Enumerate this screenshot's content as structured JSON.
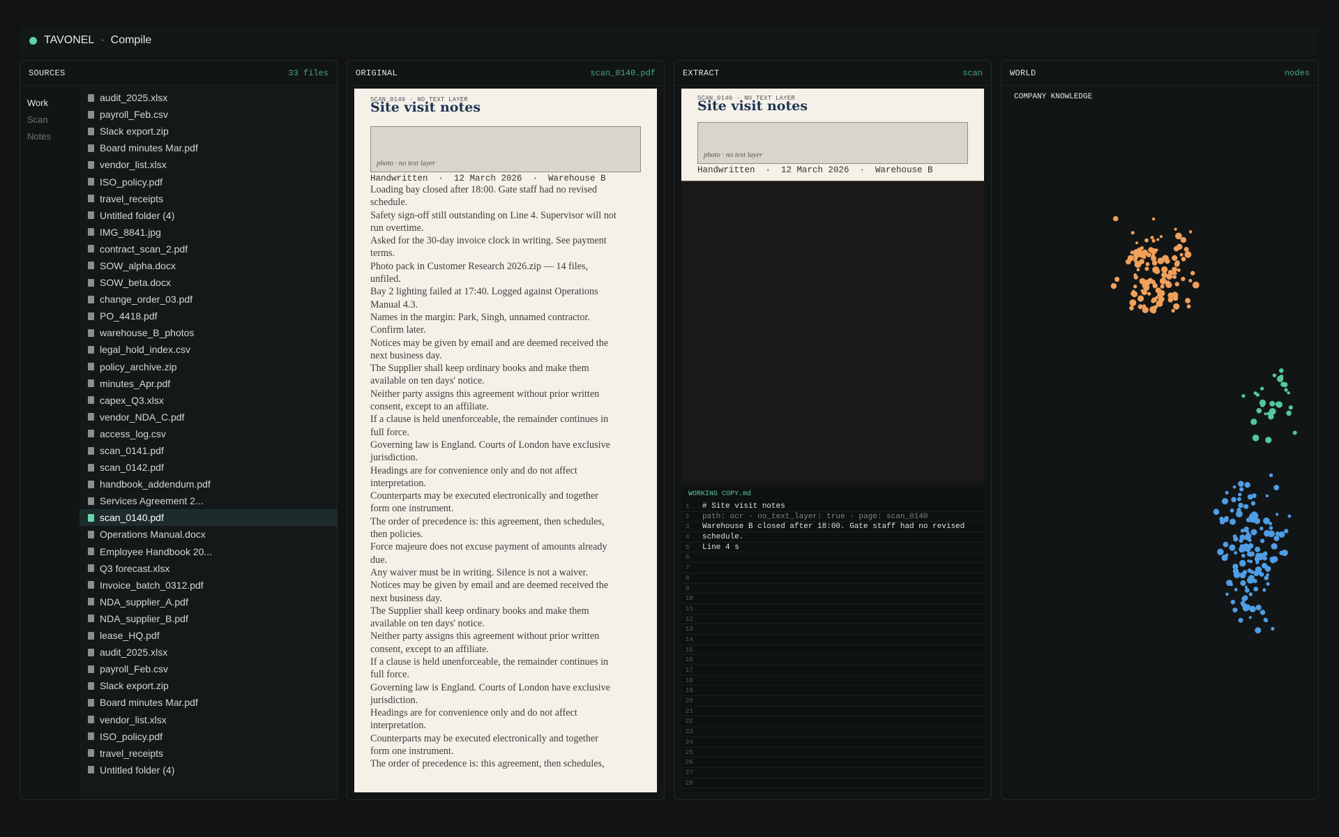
{
  "app": {
    "name": "TAVONEL",
    "separator": "·",
    "mode": "Compile",
    "status_color": "#5fd3a6"
  },
  "sources": {
    "title": "SOURCES",
    "count": "33 files",
    "nav": [
      "Work",
      "Scan",
      "Notes"
    ],
    "selected": "scan_0140.pdf",
    "files": [
      "audit_2025.xlsx",
      "payroll_Feb.csv",
      "Slack export.zip",
      "Board minutes Mar.pdf",
      "vendor_list.xlsx",
      "ISO_policy.pdf",
      "travel_receipts",
      "Untitled folder (4)",
      "IMG_8841.jpg",
      "contract_scan_2.pdf",
      "SOW_alpha.docx",
      "SOW_beta.docx",
      "change_order_03.pdf",
      "PO_4418.pdf",
      "warehouse_B_photos",
      "legal_hold_index.csv",
      "policy_archive.zip",
      "minutes_Apr.pdf",
      "capex_Q3.xlsx",
      "vendor_NDA_C.pdf",
      "access_log.csv",
      "scan_0141.pdf",
      "scan_0142.pdf",
      "handbook_addendum.pdf",
      "Services Agreement 2...",
      "scan_0140.pdf",
      "Operations Manual.docx",
      "Employee Handbook 20...",
      "Q3 forecast.xlsx",
      "Invoice_batch_0312.pdf",
      "NDA_supplier_A.pdf",
      "NDA_supplier_B.pdf",
      "lease_HQ.pdf",
      "audit_2025.xlsx",
      "payroll_Feb.csv",
      "Slack export.zip",
      "Board minutes Mar.pdf",
      "vendor_list.xlsx",
      "ISO_policy.pdf",
      "travel_receipts",
      "Untitled folder (4)"
    ]
  },
  "original": {
    "title": "ORIGINAL",
    "file": "scan_0140.pdf",
    "tag": "SCAN_0140  ·  NO TEXT LAYER",
    "doc_title": "Site visit notes",
    "photo_caption": "photo · no text layer",
    "meta": "Handwritten  ·  12 March 2026  ·  Warehouse B",
    "lines": [
      "Loading bay closed after 18:00. Gate staff had no revised",
      "schedule.",
      "Safety sign-off still outstanding on Line 4. Supervisor will not",
      "run overtime.",
      "Asked for the 30-day invoice clock in writing. See payment",
      "terms.",
      "Photo pack in Customer Research 2026.zip — 14 files,",
      "unfiled.",
      "Bay 2 lighting failed at 17:40. Logged against Operations",
      "Manual 4.3.",
      "Names in the margin: Park, Singh, unnamed contractor.",
      "Confirm later.",
      "Notices may be given by email and are deemed received the",
      "next business day.",
      "The Supplier shall keep ordinary books and make them",
      "available on ten days' notice.",
      "Neither party assigns this agreement without prior written",
      "consent, except to an affiliate.",
      "If a clause is held unenforceable, the remainder continues in",
      "full force.",
      "Governing law is England. Courts of London have exclusive",
      "jurisdiction.",
      "Headings are for convenience only and do not affect",
      "interpretation.",
      "Counterparts may be executed electronically and together",
      "form one instrument.",
      "The order of precedence is: this agreement, then schedules,",
      "then policies.",
      "Force majeure does not excuse payment of amounts already",
      "due.",
      "Any waiver must be in writing. Silence is not a waiver.",
      "Notices may be given by email and are deemed received the",
      "next business day.",
      "The Supplier shall keep ordinary books and make them",
      "available on ten days' notice.",
      "Neither party assigns this agreement without prior written",
      "consent, except to an affiliate.",
      "If a clause is held unenforceable, the remainder continues in",
      "full force.",
      "Governing law is England. Courts of London have exclusive",
      "jurisdiction.",
      "Headings are for convenience only and do not affect",
      "interpretation.",
      "Counterparts may be executed electronically and together",
      "form one instrument.",
      "The order of precedence is: this agreement, then schedules,"
    ]
  },
  "extract": {
    "title": "EXTRACT",
    "mode": "scan",
    "editor_title": "WORKING COPY.md",
    "editor_lines": [
      {
        "text": "# Site visit notes",
        "dim": false
      },
      {
        "text": "path: ocr · no_text_layer: true · page: scan_0140",
        "dim": true
      },
      {
        "text": "Warehouse B closed after 18:00. Gate staff had no revised",
        "dim": false
      },
      {
        "text": "schedule.",
        "dim": false
      },
      {
        "text": "Line 4 s",
        "dim": false
      }
    ],
    "line_count": 28
  },
  "world": {
    "title": "WORLD",
    "meta": "nodes",
    "label": "COMPANY KNOWLEDGE",
    "cluster_colors": [
      "#f0a05a",
      "#52c99a",
      "#4f9de4"
    ]
  }
}
